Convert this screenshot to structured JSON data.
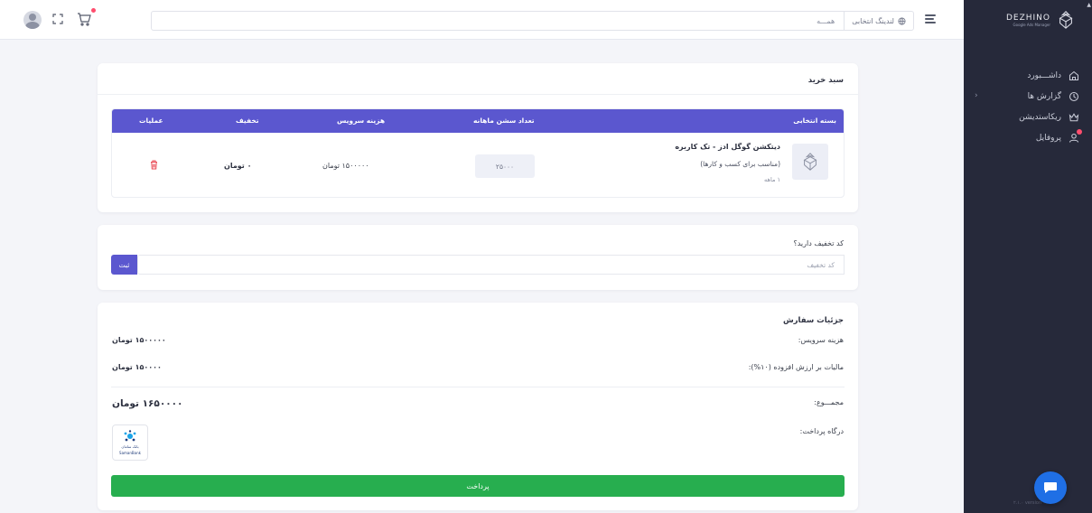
{
  "sidebar": {
    "logo_text": "DEZHINO",
    "logo_subtext": "Google Ads Manager",
    "items": [
      {
        "label": "داشـــبورد",
        "icon": "home-icon"
      },
      {
        "label": "گزارش ها",
        "icon": "clock-icon",
        "has_chevron": true
      },
      {
        "label": "ریکاستدیشن",
        "icon": "crown-icon"
      },
      {
        "label": "پروفایل",
        "icon": "user-icon",
        "has_badge": true
      }
    ],
    "chevron": "‹",
    "version": "۲.۱.۰ version"
  },
  "topbar": {
    "search_selector_label": "لندینگ انتخابی",
    "search_scope": "همـــه",
    "icons": [
      "avatar",
      "fullscreen-icon",
      "cart-icon",
      "globe-icon",
      "hamburger-icon"
    ]
  },
  "cart": {
    "title": "سبد خرید",
    "columns": {
      "package": "بسته انتخابی",
      "sessions": "تعداد سشن ماهانه",
      "service_cost": "هزینه سرویس",
      "discount": "تخفیف",
      "actions": "عملیات"
    },
    "row": {
      "name": "دیتکشن گوگل ادز - تک کاربره",
      "note": "(مناسب برای کسب و کارها)",
      "duration": "۱ ماهه",
      "sessions": "۲۵۰۰۰",
      "service_cost": "۱۵۰۰۰۰۰ تومان",
      "discount": "۰ تومان"
    }
  },
  "coupon": {
    "question": "کد تخفیف دارید؟",
    "placeholder": "کد تخفیف",
    "submit_label": "ثبت"
  },
  "order": {
    "title": "جزئیات سفارش",
    "service_cost_label": "هزینه سرویس:",
    "service_cost_value": "۱۵۰۰۰۰۰ تومان",
    "vat_label": "مالیات بر ارزش افزوده (۱۰%):",
    "vat_value": "۱۵۰۰۰۰ تومان",
    "total_label": "مجمـــوع:",
    "total_value": "۱۶۵۰۰۰۰ تومان",
    "gateway_label": "درگاه پرداخت:",
    "gateway_name": "بانک سامان",
    "gateway_name_en": "SamanBank",
    "pay_label": "پرداخت"
  },
  "colors": {
    "accent": "#5b57cf",
    "sidebar_bg": "#26293a",
    "pay_green": "#27ae4f",
    "danger": "#e8434e",
    "chat_blue": "#1f6fe5"
  }
}
